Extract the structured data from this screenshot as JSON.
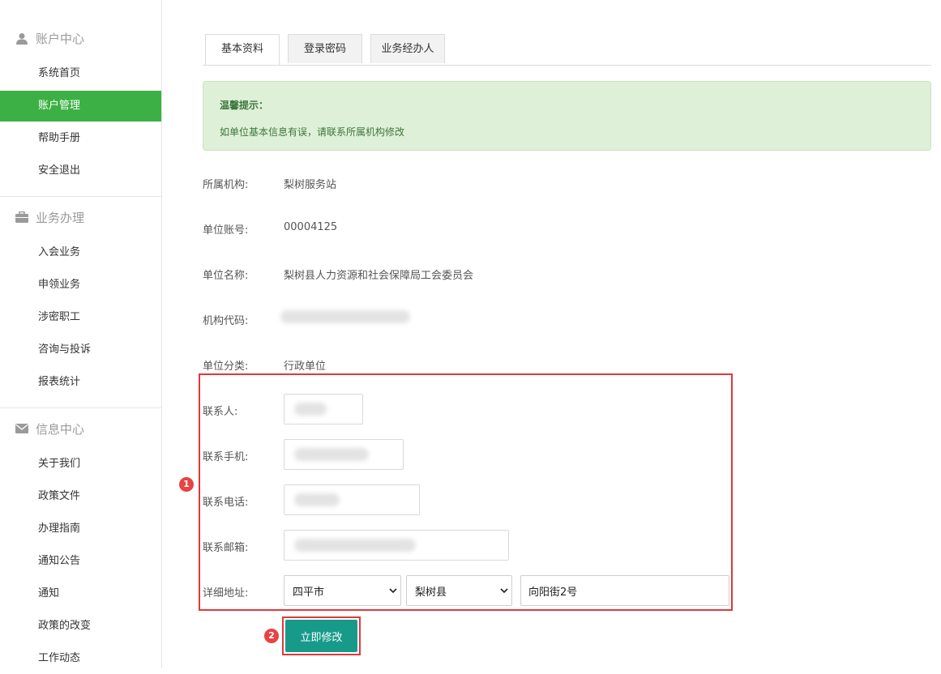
{
  "sidebar": {
    "groups": [
      {
        "title": "账户中心",
        "icon": "user-icon",
        "items": [
          "系统首页",
          "账户管理",
          "帮助手册",
          "安全退出"
        ]
      },
      {
        "title": "业务办理",
        "icon": "briefcase-icon",
        "items": [
          "入会业务",
          "申领业务",
          "涉密职工",
          "咨询与投诉",
          "报表统计"
        ]
      },
      {
        "title": "信息中心",
        "icon": "envelope-icon",
        "items": [
          "关于我们",
          "政策文件",
          "办理指南",
          "通知公告",
          "通知",
          "政策的改变",
          "工作动态"
        ]
      }
    ],
    "active_item": "账户管理",
    "accent_color": "#3cb045"
  },
  "tabs": [
    "基本资料",
    "登录密码",
    "业务经办人"
  ],
  "active_tab": "基本资料",
  "alert": {
    "title": "温馨提示：",
    "text": "如单位基本信息有误，请联系所属机构修改"
  },
  "info": {
    "org_label": "所属机构:",
    "org_value": "梨树服务站",
    "account_label": "单位账号:",
    "account_value": "00004125",
    "name_label": "单位名称:",
    "name_value": "梨树县人力资源和社会保障局工会委员会",
    "code_label": "机构代码:",
    "category_label": "单位分类:",
    "category_value": "行政单位"
  },
  "contact": {
    "person_label": "联系人:",
    "mobile_label": "联系手机:",
    "phone_label": "联系电话:",
    "email_label": "联系邮箱:",
    "address_label": "详细地址:",
    "city_selected": "四平市",
    "county_selected": "梨树县",
    "street_value": "向阳街2号"
  },
  "markers": {
    "first": "1",
    "second": "2"
  },
  "submit_label": "立即修改",
  "colors": {
    "button": "#179a8a",
    "annotation": "#e0383b",
    "alert_bg": "#dff0d8"
  }
}
